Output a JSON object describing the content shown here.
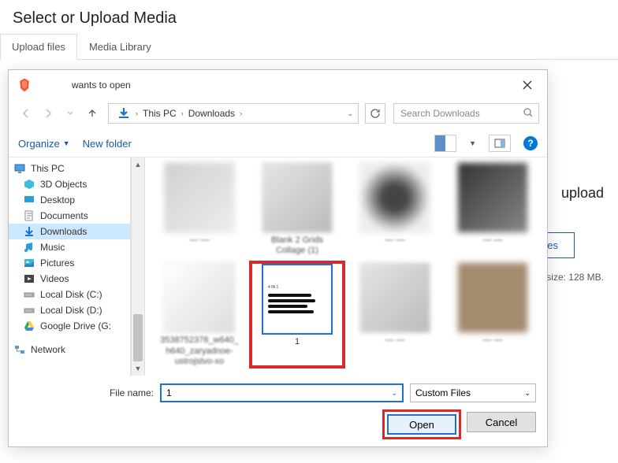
{
  "page": {
    "title": "Select or Upload Media",
    "tabs": [
      "Upload files",
      "Media Library"
    ],
    "behind_label": "upload",
    "behind_button": "es",
    "behind_size": "size: 128 MB."
  },
  "dialog": {
    "title": "wants to open",
    "breadcrumb": {
      "root": "This PC",
      "folder": "Downloads"
    },
    "search_placeholder": "Search Downloads",
    "toolbar": {
      "organize": "Organize",
      "new_folder": "New folder"
    },
    "sidebar": {
      "this_pc": "This PC",
      "items": [
        "3D Objects",
        "Desktop",
        "Documents",
        "Downloads",
        "Music",
        "Pictures",
        "Videos",
        "Local Disk (C:)",
        "Local Disk (D:)",
        "Google Drive (G:"
      ],
      "network": "Network"
    },
    "files": {
      "row1": [
        "",
        "",
        "",
        ""
      ],
      "row1_labels": [
        "",
        "Blank 2 Grids Collage (1)",
        "",
        ""
      ],
      "selected_label": "1",
      "long_label": "3538752378_w640_h640_zaryadnoe-ustrojstvo-xo"
    },
    "footer": {
      "filename_label": "File name:",
      "filename_value": "1",
      "filter": "Custom Files",
      "open": "Open",
      "cancel": "Cancel"
    }
  }
}
